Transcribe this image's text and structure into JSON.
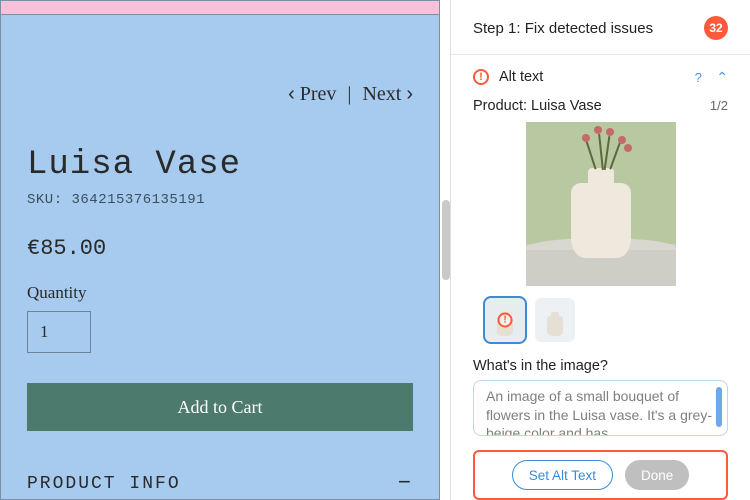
{
  "preview": {
    "prev": "Prev",
    "next": "Next",
    "product_title": "Luisa Vase",
    "sku_label": "SKU: 364215376135191",
    "price": "€85.00",
    "quantity_label": "Quantity",
    "quantity_value": "1",
    "add_to_cart": "Add to Cart",
    "product_info_tab": "PRODUCT INFO"
  },
  "panel": {
    "step_label": "Step 1: Fix detected issues",
    "issue_count": "32",
    "section_title": "Alt text",
    "product_label": "Product: Luisa Vase",
    "image_index": "1/2",
    "prompt": "What's in the image?",
    "alt_text_value": "An image of a small bouquet of flowers in the Luisa vase. It's a grey-beige color and has",
    "set_alt_text": "Set Alt Text",
    "done": "Done"
  }
}
